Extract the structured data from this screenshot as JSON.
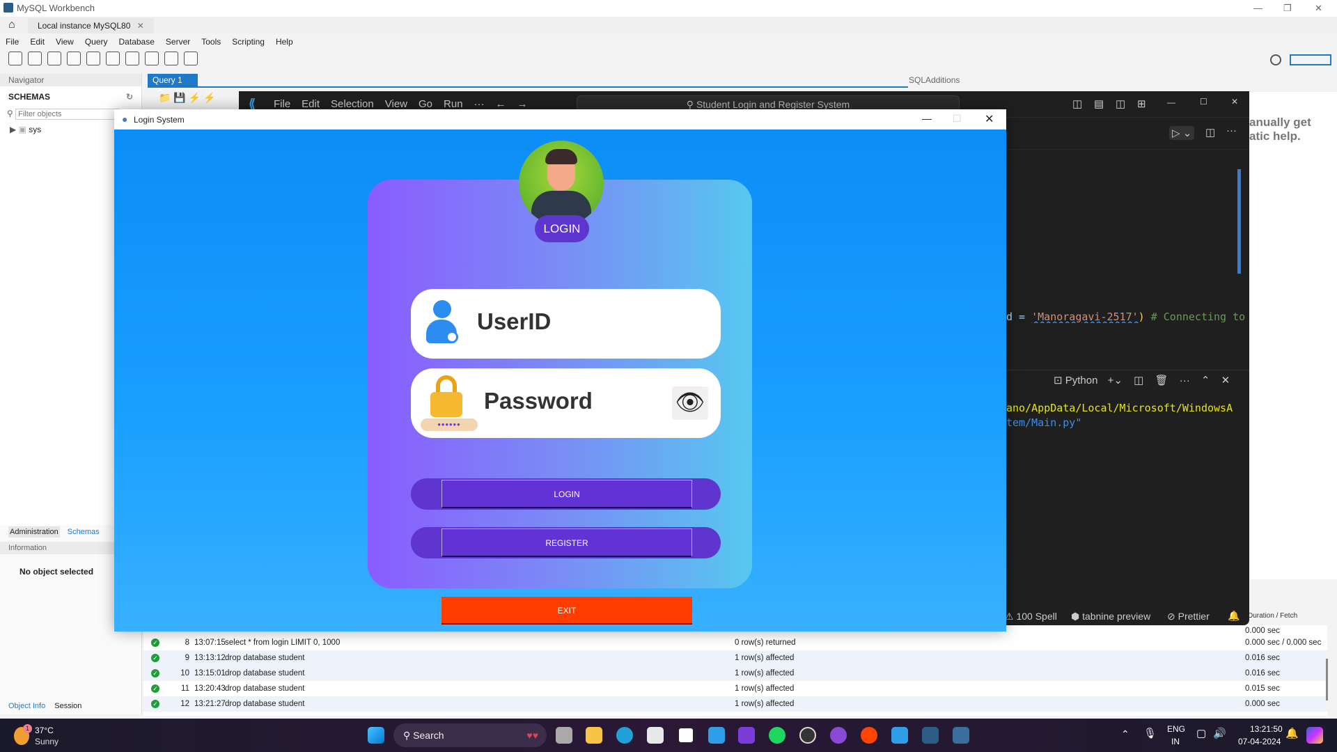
{
  "workbench": {
    "title": "MySQL Workbench",
    "instance_tab": "Local instance MySQL80",
    "menu": [
      "File",
      "Edit",
      "View",
      "Query",
      "Database",
      "Server",
      "Tools",
      "Scripting",
      "Help"
    ],
    "navigator_label": "Navigator",
    "schemas_label": "SCHEMAS",
    "filter_placeholder": "Filter objects",
    "schema_items": [
      "sys"
    ],
    "bottom_tabs": [
      "Administration",
      "Schemas"
    ],
    "information_label": "Information",
    "no_object": "No object selected",
    "object_tabs": [
      "Object Info",
      "Session"
    ],
    "query_tab": "Query 1",
    "sql_additions": "SQLAdditions",
    "help_text": [
      "anually get",
      "atic help."
    ],
    "log_header_duration": "Duration / Fetch",
    "log_first_duration": "0.000 sec",
    "log": [
      {
        "n": "8",
        "time": "13:07:15",
        "action": "select * from login LIMIT 0, 1000",
        "message": "0 row(s) returned",
        "duration": "0.000 sec / 0.000 sec"
      },
      {
        "n": "9",
        "time": "13:13:12",
        "action": "drop database student",
        "message": "1 row(s) affected",
        "duration": "0.016 sec"
      },
      {
        "n": "10",
        "time": "13:15:01",
        "action": "drop database student",
        "message": "1 row(s) affected",
        "duration": "0.016 sec"
      },
      {
        "n": "11",
        "time": "13:20:43",
        "action": "drop database student",
        "message": "1 row(s) affected",
        "duration": "0.015 sec"
      },
      {
        "n": "12",
        "time": "13:21:27",
        "action": "drop database student",
        "message": "1 row(s) affected",
        "duration": "0.000 sec"
      }
    ]
  },
  "vscode": {
    "menu": [
      "File",
      "Edit",
      "Selection",
      "View",
      "Go",
      "Run",
      "···"
    ],
    "search": "Student Login and Register System",
    "code": {
      "prefix": "d = ",
      "string": "'Manoragavi-2517'",
      "paren": ")",
      "comment": " # Connecting to"
    },
    "terminal_label": "Python",
    "terminal_lines": [
      "ano/AppData/Local/Microsoft/WindowsA",
      "tem/Main.py\""
    ],
    "status": {
      "spell": "100 Spell",
      "tabnine": "tabnine preview",
      "prettier": "Prettier"
    }
  },
  "login": {
    "window_title": "Login System",
    "badge": "LOGIN",
    "userid_label": "UserID",
    "password_label": "Password",
    "password_mask": "••••••",
    "login_button": "LOGIN",
    "register_button": "REGISTER",
    "exit_button": "EXIT",
    "colors": {
      "exit": "#ff3d00",
      "button": "#5e35cf",
      "card_left": "#8a5cff",
      "card_right": "#56c8f0"
    }
  },
  "taskbar": {
    "weather_temp": "37°C",
    "weather_desc": "Sunny",
    "weather_badge": "1",
    "search": "Search",
    "lang": "ENG",
    "region": "IN",
    "time": "13:21:50",
    "date": "07-04-2024"
  }
}
